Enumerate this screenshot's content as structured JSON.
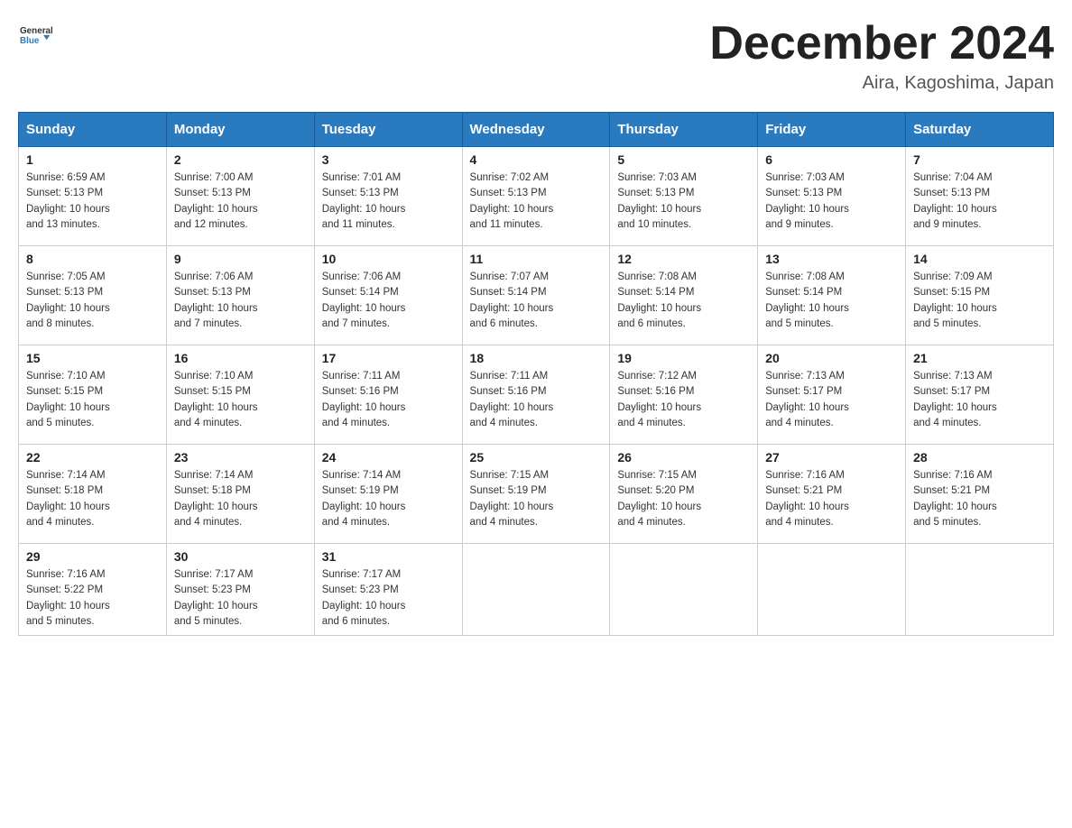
{
  "logo": {
    "text_general": "General",
    "text_blue": "Blue"
  },
  "header": {
    "month": "December 2024",
    "location": "Aira, Kagoshima, Japan"
  },
  "weekdays": [
    "Sunday",
    "Monday",
    "Tuesday",
    "Wednesday",
    "Thursday",
    "Friday",
    "Saturday"
  ],
  "weeks": [
    [
      {
        "day": "1",
        "sunrise": "6:59 AM",
        "sunset": "5:13 PM",
        "daylight": "10 hours and 13 minutes."
      },
      {
        "day": "2",
        "sunrise": "7:00 AM",
        "sunset": "5:13 PM",
        "daylight": "10 hours and 12 minutes."
      },
      {
        "day": "3",
        "sunrise": "7:01 AM",
        "sunset": "5:13 PM",
        "daylight": "10 hours and 11 minutes."
      },
      {
        "day": "4",
        "sunrise": "7:02 AM",
        "sunset": "5:13 PM",
        "daylight": "10 hours and 11 minutes."
      },
      {
        "day": "5",
        "sunrise": "7:03 AM",
        "sunset": "5:13 PM",
        "daylight": "10 hours and 10 minutes."
      },
      {
        "day": "6",
        "sunrise": "7:03 AM",
        "sunset": "5:13 PM",
        "daylight": "10 hours and 9 minutes."
      },
      {
        "day": "7",
        "sunrise": "7:04 AM",
        "sunset": "5:13 PM",
        "daylight": "10 hours and 9 minutes."
      }
    ],
    [
      {
        "day": "8",
        "sunrise": "7:05 AM",
        "sunset": "5:13 PM",
        "daylight": "10 hours and 8 minutes."
      },
      {
        "day": "9",
        "sunrise": "7:06 AM",
        "sunset": "5:13 PM",
        "daylight": "10 hours and 7 minutes."
      },
      {
        "day": "10",
        "sunrise": "7:06 AM",
        "sunset": "5:14 PM",
        "daylight": "10 hours and 7 minutes."
      },
      {
        "day": "11",
        "sunrise": "7:07 AM",
        "sunset": "5:14 PM",
        "daylight": "10 hours and 6 minutes."
      },
      {
        "day": "12",
        "sunrise": "7:08 AM",
        "sunset": "5:14 PM",
        "daylight": "10 hours and 6 minutes."
      },
      {
        "day": "13",
        "sunrise": "7:08 AM",
        "sunset": "5:14 PM",
        "daylight": "10 hours and 5 minutes."
      },
      {
        "day": "14",
        "sunrise": "7:09 AM",
        "sunset": "5:15 PM",
        "daylight": "10 hours and 5 minutes."
      }
    ],
    [
      {
        "day": "15",
        "sunrise": "7:10 AM",
        "sunset": "5:15 PM",
        "daylight": "10 hours and 5 minutes."
      },
      {
        "day": "16",
        "sunrise": "7:10 AM",
        "sunset": "5:15 PM",
        "daylight": "10 hours and 4 minutes."
      },
      {
        "day": "17",
        "sunrise": "7:11 AM",
        "sunset": "5:16 PM",
        "daylight": "10 hours and 4 minutes."
      },
      {
        "day": "18",
        "sunrise": "7:11 AM",
        "sunset": "5:16 PM",
        "daylight": "10 hours and 4 minutes."
      },
      {
        "day": "19",
        "sunrise": "7:12 AM",
        "sunset": "5:16 PM",
        "daylight": "10 hours and 4 minutes."
      },
      {
        "day": "20",
        "sunrise": "7:13 AM",
        "sunset": "5:17 PM",
        "daylight": "10 hours and 4 minutes."
      },
      {
        "day": "21",
        "sunrise": "7:13 AM",
        "sunset": "5:17 PM",
        "daylight": "10 hours and 4 minutes."
      }
    ],
    [
      {
        "day": "22",
        "sunrise": "7:14 AM",
        "sunset": "5:18 PM",
        "daylight": "10 hours and 4 minutes."
      },
      {
        "day": "23",
        "sunrise": "7:14 AM",
        "sunset": "5:18 PM",
        "daylight": "10 hours and 4 minutes."
      },
      {
        "day": "24",
        "sunrise": "7:14 AM",
        "sunset": "5:19 PM",
        "daylight": "10 hours and 4 minutes."
      },
      {
        "day": "25",
        "sunrise": "7:15 AM",
        "sunset": "5:19 PM",
        "daylight": "10 hours and 4 minutes."
      },
      {
        "day": "26",
        "sunrise": "7:15 AM",
        "sunset": "5:20 PM",
        "daylight": "10 hours and 4 minutes."
      },
      {
        "day": "27",
        "sunrise": "7:16 AM",
        "sunset": "5:21 PM",
        "daylight": "10 hours and 4 minutes."
      },
      {
        "day": "28",
        "sunrise": "7:16 AM",
        "sunset": "5:21 PM",
        "daylight": "10 hours and 5 minutes."
      }
    ],
    [
      {
        "day": "29",
        "sunrise": "7:16 AM",
        "sunset": "5:22 PM",
        "daylight": "10 hours and 5 minutes."
      },
      {
        "day": "30",
        "sunrise": "7:17 AM",
        "sunset": "5:23 PM",
        "daylight": "10 hours and 5 minutes."
      },
      {
        "day": "31",
        "sunrise": "7:17 AM",
        "sunset": "5:23 PM",
        "daylight": "10 hours and 6 minutes."
      },
      null,
      null,
      null,
      null
    ]
  ],
  "labels": {
    "sunrise": "Sunrise:",
    "sunset": "Sunset:",
    "daylight": "Daylight:"
  }
}
